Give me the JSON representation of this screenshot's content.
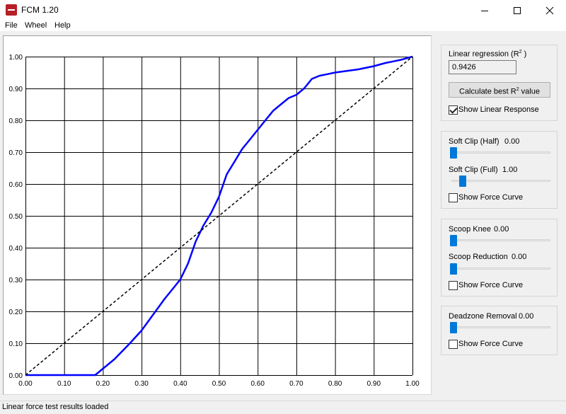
{
  "window": {
    "title": "FCM 1.20",
    "icon": "app-logo-icon"
  },
  "menu": [
    {
      "label": "File"
    },
    {
      "label": "Wheel"
    },
    {
      "label": "Help"
    }
  ],
  "linear_group": {
    "title": "Linear regression (R",
    "sup": "2",
    "title_end": " )",
    "value": "0.9426",
    "button_text": "Calculate best R",
    "button_sup": "2",
    "button_end": " value",
    "checkbox_label": "Show Linear Response",
    "checkbox_checked": true
  },
  "softclip_group": {
    "half_label": "Soft Clip (Half)",
    "half_value": "0.00",
    "full_label": "Soft Clip (Full)",
    "full_value": "1.00",
    "checkbox_label": "Show Force Curve",
    "checkbox_checked": false
  },
  "scoop_group": {
    "knee_label": "Scoop Knee",
    "knee_value": "0.00",
    "reduction_label": "Scoop Reduction",
    "reduction_value": "0.00",
    "checkbox_label": "Show Force Curve",
    "checkbox_checked": false
  },
  "deadzone_group": {
    "label": "Deadzone Removal",
    "value": "0.00",
    "checkbox_label": "Show Force Curve",
    "checkbox_checked": false
  },
  "status": {
    "text": "Linear force test results loaded"
  },
  "colors": {
    "curve": "#0000ff",
    "reference": "#000000",
    "slider_thumb": "#0078d7",
    "grid": "#000000"
  },
  "chart_data": {
    "type": "line",
    "title": "",
    "xlabel": "",
    "ylabel": "",
    "xlim": [
      0,
      1
    ],
    "ylim": [
      0,
      1
    ],
    "grid": true,
    "x_ticks": [
      "0.00",
      "0.10",
      "0.20",
      "0.30",
      "0.40",
      "0.50",
      "0.60",
      "0.70",
      "0.80",
      "0.90",
      "1.00"
    ],
    "y_ticks": [
      "0.00",
      "0.10",
      "0.20",
      "0.30",
      "0.40",
      "0.50",
      "0.60",
      "0.70",
      "0.80",
      "0.90",
      "1.00"
    ],
    "series": [
      {
        "style": "solid",
        "color": "#0000ff",
        "x": [
          0.0,
          0.1,
          0.18,
          0.2,
          0.23,
          0.27,
          0.3,
          0.33,
          0.36,
          0.38,
          0.4,
          0.42,
          0.44,
          0.46,
          0.48,
          0.5,
          0.52,
          0.54,
          0.56,
          0.58,
          0.6,
          0.62,
          0.64,
          0.66,
          0.68,
          0.7,
          0.72,
          0.74,
          0.76,
          0.78,
          0.8,
          0.83,
          0.86,
          0.9,
          0.93,
          0.95,
          0.97,
          1.0
        ],
        "y": [
          0.0,
          0.0,
          0.0,
          0.02,
          0.05,
          0.1,
          0.14,
          0.19,
          0.24,
          0.27,
          0.3,
          0.35,
          0.42,
          0.47,
          0.51,
          0.56,
          0.63,
          0.67,
          0.71,
          0.74,
          0.77,
          0.8,
          0.83,
          0.85,
          0.87,
          0.88,
          0.9,
          0.93,
          0.94,
          0.945,
          0.95,
          0.955,
          0.96,
          0.97,
          0.98,
          0.985,
          0.99,
          1.0
        ]
      },
      {
        "style": "dashed",
        "color": "#000000",
        "x": [
          0,
          1
        ],
        "y": [
          0,
          1
        ]
      }
    ]
  }
}
